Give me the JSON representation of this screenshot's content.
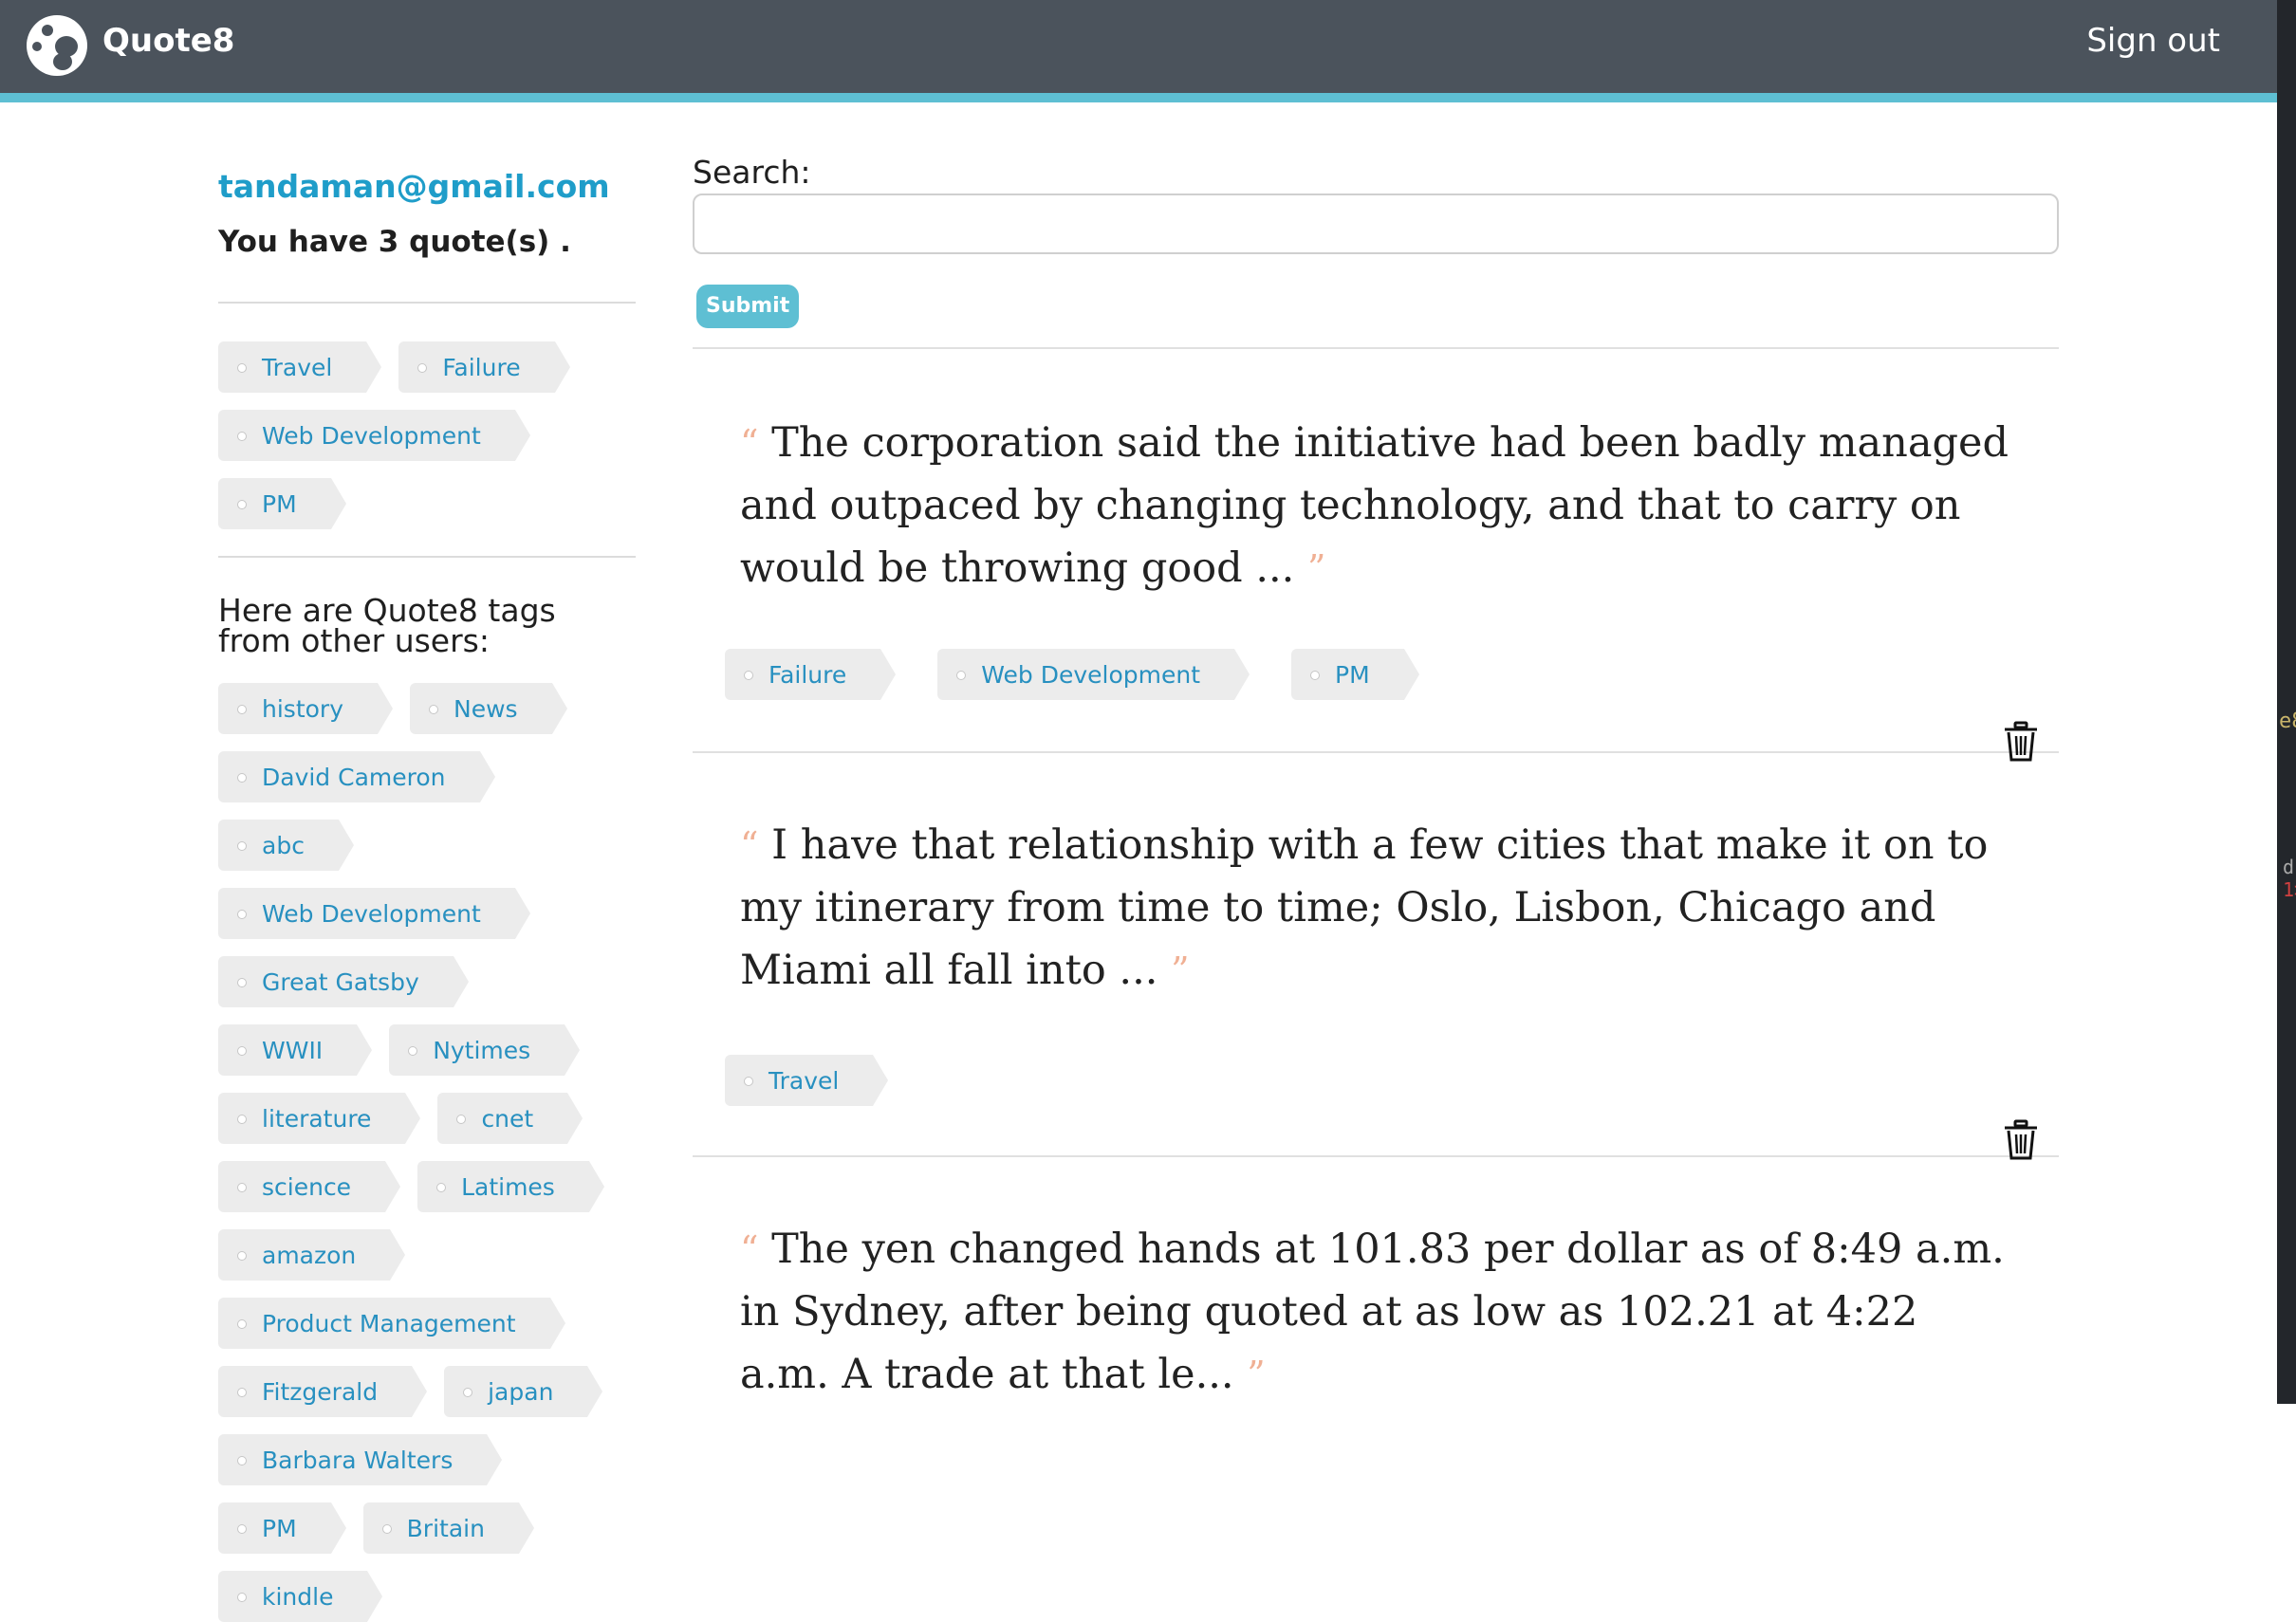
{
  "app": {
    "name": "Quote8",
    "sign_out": "Sign out"
  },
  "sidebar": {
    "email": "tandaman@gmail.com",
    "quote_count_text": "You have 3 quote(s) .",
    "my_tags": [
      "Travel",
      "Failure",
      "Web Development",
      "PM"
    ],
    "other_tags_heading": "Here are Quote8 tags from other users:",
    "other_tags": [
      "history",
      "News",
      "David Cameron",
      "abc",
      "Web Development",
      "Great Gatsby",
      "WWII",
      "Nytimes",
      "literature",
      "cnet",
      "science",
      "Latimes",
      "amazon",
      "Product Management",
      "Fitzgerald",
      "japan",
      "Barbara Walters",
      "PM",
      "Britain",
      "kindle"
    ]
  },
  "search": {
    "label": "Search:",
    "value": "",
    "placeholder": "",
    "submit_label": "Submit"
  },
  "quotes": [
    {
      "text": "The corporation said the initiative had been badly managed and outpaced by changing technology, and that to carry on would be throwing good ...",
      "tags": [
        "Failure",
        "Web Development",
        "PM"
      ]
    },
    {
      "text": "I have that relationship with a few cities that make it on to my itinerary from time to time; Oslo, Lisbon, Chicago and Miami all fall into ...",
      "tags": [
        "Travel"
      ]
    },
    {
      "text": "The yen changed hands at 101.83 per dollar as of 8:49 a.m. in Sydney, after being quoted at as low as 102.21 at 4:22 a.m. A trade at that le...",
      "tags": []
    }
  ],
  "colors": {
    "topbar": "#4b535c",
    "accent": "#5ebfd3",
    "link": "#1f9dc9",
    "tag_bg": "#ececec",
    "quote_mark": "#f0b094"
  }
}
